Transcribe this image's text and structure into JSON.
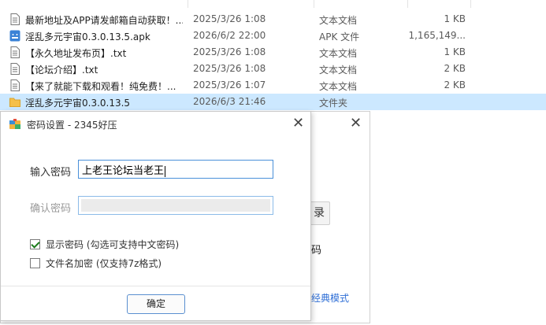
{
  "files": [
    {
      "name": "最新地址及APP请发邮箱自动获取！...",
      "date": "2025/3/26 1:08",
      "type": "文本文档",
      "size": "1 KB",
      "icon": "text-file-icon"
    },
    {
      "name": "淫乱多元宇宙0.3.0.13.5.apk",
      "date": "2026/6/2 22:00",
      "type": "APK 文件",
      "size": "1,165,149...",
      "icon": "apk-file-icon"
    },
    {
      "name": "【永久地址发布页】.txt",
      "date": "2025/3/26 1:08",
      "type": "文本文档",
      "size": "1 KB",
      "icon": "text-file-icon"
    },
    {
      "name": "【论坛介绍】.txt",
      "date": "2025/3/26 1:08",
      "type": "文本文档",
      "size": "2 KB",
      "icon": "text-file-icon"
    },
    {
      "name": "【来了就能下载和观看！纯免费！...",
      "date": "2025/3/26 1:07",
      "type": "文本文档",
      "size": "2 KB",
      "icon": "text-file-icon"
    },
    {
      "name": "淫乱多元宇宙0.3.0.13.5",
      "date": "2026/6/3 21:46",
      "type": "文件夹",
      "size": "",
      "icon": "folder-icon"
    }
  ],
  "background_dialog": {
    "button_label": "录",
    "text": "码",
    "link": "经典模式"
  },
  "dialog": {
    "title": "密码设置 - 2345好压",
    "password_label": "输入密码",
    "password_value": "上老王论坛当老王",
    "confirm_label": "确认密码",
    "show_password_label": "显示密码 (勾选可支持中文密码)",
    "show_password_checked": true,
    "encrypt_filename_label": "文件名加密 (仅支持7z格式)",
    "encrypt_filename_checked": false,
    "ok_label": "确定"
  },
  "colors": {
    "selected_row": "#cce8ff",
    "accent": "#4a90d9",
    "link": "#2f6fd6"
  }
}
